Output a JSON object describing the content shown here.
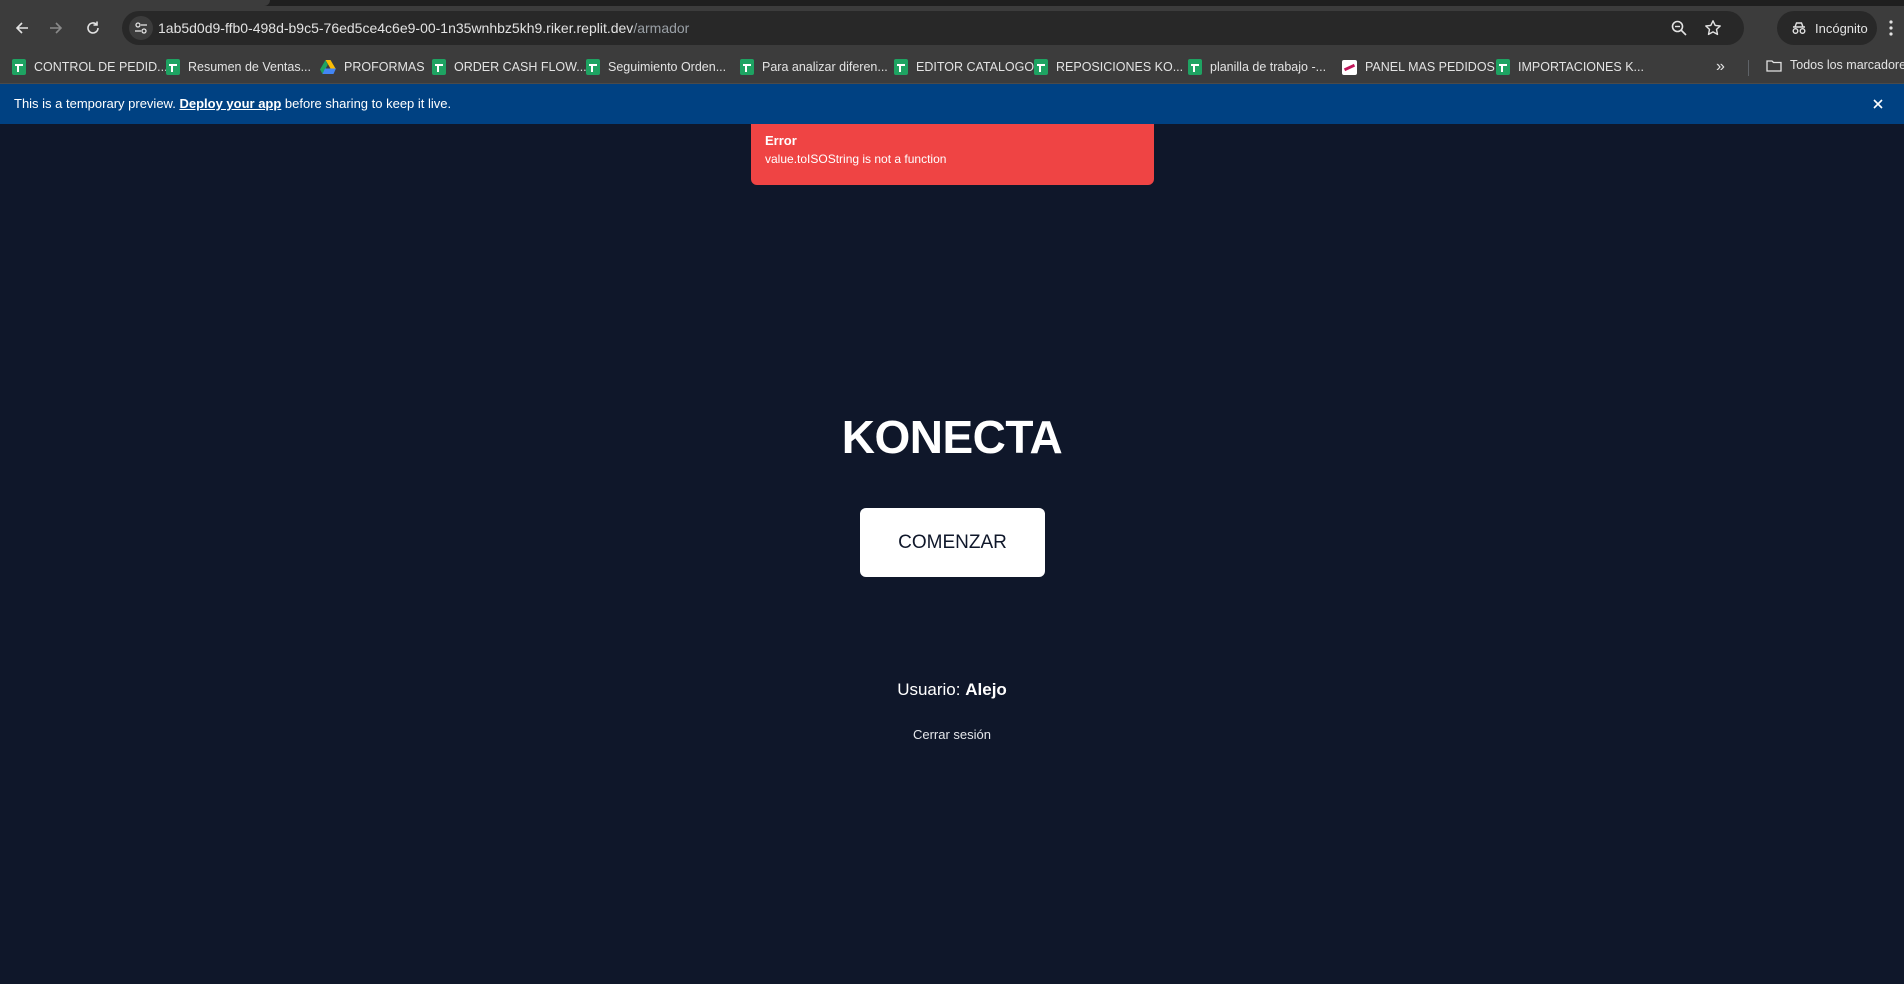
{
  "browser": {
    "url_host": "1ab5d0d9-ffb0-498d-b9c5-76ed5ce4c6e9-00-1n35wnhbz5kh9.riker.replit.dev",
    "url_path": "/armador",
    "incognito_label": "Incógnito",
    "bookmarks": [
      {
        "label": "CONTROL DE PEDID...",
        "icon": "sheets-icon"
      },
      {
        "label": "Resumen de Ventas...",
        "icon": "sheets-icon"
      },
      {
        "label": "PROFORMAS",
        "icon": "drive-icon"
      },
      {
        "label": "ORDER CASH FLOW...",
        "icon": "sheets-icon"
      },
      {
        "label": "Seguimiento Orden...",
        "icon": "sheets-icon"
      },
      {
        "label": "Para analizar diferen...",
        "icon": "sheets-icon"
      },
      {
        "label": "EDITOR CATALOGO",
        "icon": "sheets-icon"
      },
      {
        "label": "REPOSICIONES KO...",
        "icon": "sheets-icon"
      },
      {
        "label": "planilla de trabajo -...",
        "icon": "sheets-icon"
      },
      {
        "label": "PANEL MAS PEDIDOS",
        "icon": "panel-icon"
      },
      {
        "label": "IMPORTACIONES K...",
        "icon": "sheets-icon"
      }
    ],
    "bookmarks_folder_label": "Todos los marcadores"
  },
  "preview_banner": {
    "text_before": "This is a temporary preview. ",
    "link_label": "Deploy your app",
    "text_after": " before sharing to keep it live."
  },
  "toast": {
    "title": "Error",
    "message": "value.toISOString is not a function",
    "color": "#ef4444"
  },
  "app": {
    "title": "KONECTA",
    "start_button": "COMENZAR",
    "user_label": "Usuario:",
    "user_name": "Alejo",
    "logout_label": "Cerrar sesión",
    "background_color": "#0f172a"
  }
}
